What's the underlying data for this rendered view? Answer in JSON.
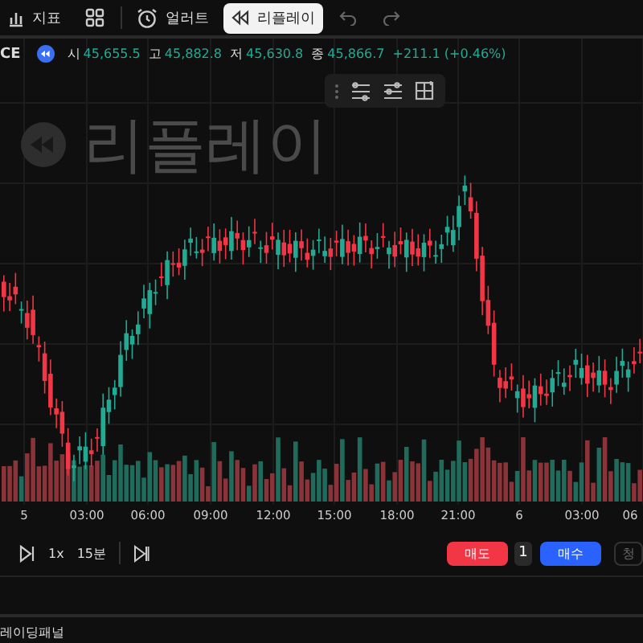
{
  "toolbar": [
    {
      "kind": "indicators",
      "label": "지표",
      "selected": false
    },
    {
      "kind": "layout",
      "selected": false
    },
    {
      "kind": "alert",
      "label": "얼러트",
      "selected": false
    },
    {
      "kind": "replay",
      "label": "리플레이",
      "selected": true
    },
    {
      "kind": "undo",
      "selected": false
    },
    {
      "kind": "redo",
      "selected": false
    }
  ],
  "legend": {
    "symbol": "CE",
    "ohlc": [
      {
        "label": "시",
        "value": "45,655.5"
      },
      {
        "label": "고",
        "value": "45,882.8"
      },
      {
        "label": "저",
        "value": "45,630.8"
      },
      {
        "label": "종",
        "value": "45,866.7"
      }
    ],
    "change": "+211.1 (+0.46%)"
  },
  "replay_overlay": "리플레이",
  "time_axis": [
    "5",
    "03:00",
    "06:00",
    "09:00",
    "12:00",
    "15:00",
    "18:00",
    "21:00",
    "6",
    "03:00",
    "06"
  ],
  "playback": {
    "speed": "1x",
    "interval": "15분"
  },
  "order": {
    "sell": "매도",
    "quantity": "1",
    "buy": "매수",
    "close": "청"
  },
  "panel_title": "레이딩패널"
}
